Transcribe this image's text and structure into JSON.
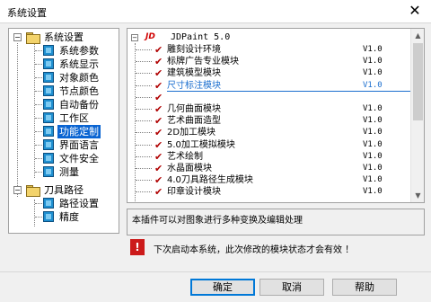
{
  "window": {
    "title": "系统设置",
    "close_glyph": "✕"
  },
  "tree": {
    "root1": {
      "label": "系统设置",
      "expander": "−"
    },
    "root1_children": [
      "系统参数",
      "系统显示",
      "对象颜色",
      "节点颜色",
      "自动备份",
      "工作区",
      "功能定制",
      "界面语言",
      "文件安全",
      "测量"
    ],
    "selected_label": "功能定制",
    "root2": {
      "label": "刀具路径",
      "expander": "−"
    },
    "root2_children": [
      "路径设置",
      "精度"
    ]
  },
  "modules": {
    "root": {
      "logo": "JD",
      "name": "JDPaint 5.0",
      "expander": "−"
    },
    "items": [
      {
        "checked": true,
        "name": "雕刻设计环境",
        "version": "V1.0"
      },
      {
        "checked": true,
        "name": "标牌广告专业模块",
        "version": "V1.0"
      },
      {
        "checked": true,
        "name": "建筑模型模块",
        "version": "V1.0"
      },
      {
        "checked": true,
        "name": "尺寸标注模块",
        "version": "V1.0",
        "highlighted": true
      },
      {
        "checked": true,
        "name": "",
        "version": ""
      },
      {
        "checked": true,
        "name": "几何曲面模块",
        "version": "V1.0"
      },
      {
        "checked": true,
        "name": "艺术曲面造型",
        "version": "V1.0"
      },
      {
        "checked": true,
        "name": "2D加工模块",
        "version": "V1.0"
      },
      {
        "checked": true,
        "name": "5.0加工模拟模块",
        "version": "V1.0"
      },
      {
        "checked": true,
        "name": "艺术绘制",
        "version": "V1.0"
      },
      {
        "checked": true,
        "name": "水晶面模块",
        "version": "V1.0"
      },
      {
        "checked": true,
        "name": "4.0刀具路径生成模块",
        "version": "V1.0"
      },
      {
        "checked": true,
        "name": "印章设计模块",
        "version": "V1.0"
      }
    ],
    "check_glyph": "✔"
  },
  "description": "本插件可以对图象进行多种变换及编辑处理",
  "warning": {
    "icon": "!",
    "text": "下次启动本系统，此次修改的模块状态才会有效 ！"
  },
  "buttons": {
    "ok": "确定",
    "cancel": "取消",
    "help": "帮助"
  },
  "colors": {
    "selection": "#0a64d2",
    "check": "#b00000",
    "highlight": "#1c6fcf",
    "warning": "#cc1a1a"
  }
}
